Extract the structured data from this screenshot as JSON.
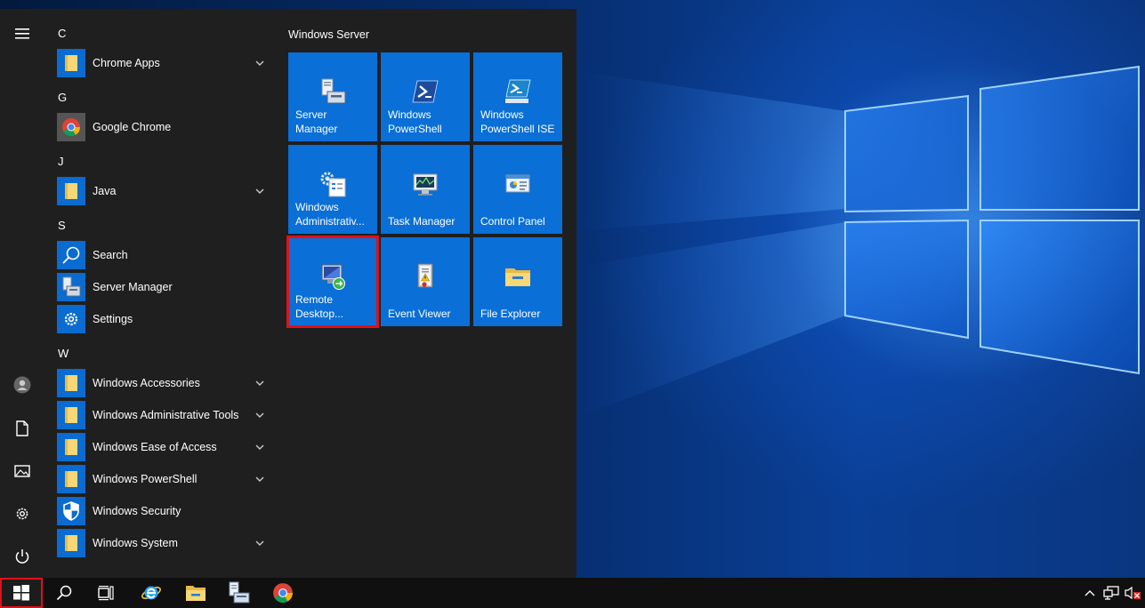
{
  "start_menu": {
    "tiles_group_title": "Windows Server",
    "letters": {
      "c": "C",
      "g": "G",
      "j": "J",
      "s": "S",
      "w": "W"
    },
    "apps": [
      {
        "label": "Chrome Apps",
        "icon": "folder-icon",
        "expandable": true
      },
      {
        "label": "Google Chrome",
        "icon": "chrome-icon",
        "expandable": false
      },
      {
        "label": "Java",
        "icon": "folder-icon",
        "expandable": true
      },
      {
        "label": "Search",
        "icon": "search-icon",
        "expandable": false
      },
      {
        "label": "Server Manager",
        "icon": "server-manager-icon",
        "expandable": false
      },
      {
        "label": "Settings",
        "icon": "gear-icon",
        "expandable": false
      },
      {
        "label": "Windows Accessories",
        "icon": "folder-icon",
        "expandable": true
      },
      {
        "label": "Windows Administrative Tools",
        "icon": "folder-icon",
        "expandable": true
      },
      {
        "label": "Windows Ease of Access",
        "icon": "folder-icon",
        "expandable": true
      },
      {
        "label": "Windows PowerShell",
        "icon": "folder-icon",
        "expandable": true
      },
      {
        "label": "Windows Security",
        "icon": "shield-icon",
        "expandable": false
      },
      {
        "label": "Windows System",
        "icon": "folder-icon",
        "expandable": true
      }
    ],
    "tiles": [
      {
        "label": "Server Manager",
        "icon": "server-manager-icon"
      },
      {
        "label": "Windows PowerShell",
        "icon": "powershell-icon"
      },
      {
        "label": "Windows PowerShell ISE",
        "icon": "powershell-ise-icon"
      },
      {
        "label": "Windows Administrativ...",
        "icon": "admin-tools-icon"
      },
      {
        "label": "Task Manager",
        "icon": "task-manager-icon"
      },
      {
        "label": "Control Panel",
        "icon": "control-panel-icon"
      },
      {
        "label": "Remote Desktop...",
        "icon": "remote-desktop-icon",
        "highlighted": true
      },
      {
        "label": "Event Viewer",
        "icon": "event-viewer-icon"
      },
      {
        "label": "File Explorer",
        "icon": "folder-icon"
      }
    ],
    "rail_icons": [
      "hamburger-icon",
      "user-icon",
      "documents-icon",
      "pictures-icon",
      "gear-icon",
      "power-icon"
    ]
  },
  "taskbar": {
    "buttons": [
      "windows-logo-icon",
      "search-icon",
      "task-view-icon",
      "internet-explorer-icon",
      "file-explorer-icon",
      "server-manager-icon",
      "chrome-icon"
    ],
    "tray": [
      "chevron-up-icon",
      "network-icon",
      "volume-muted-icon"
    ]
  },
  "colors": {
    "tile_blue": "#0a6fd6",
    "menu_bg": "#1f1f1f",
    "highlight_red": "#e0101a",
    "folder_yellow": "#f8d775"
  }
}
